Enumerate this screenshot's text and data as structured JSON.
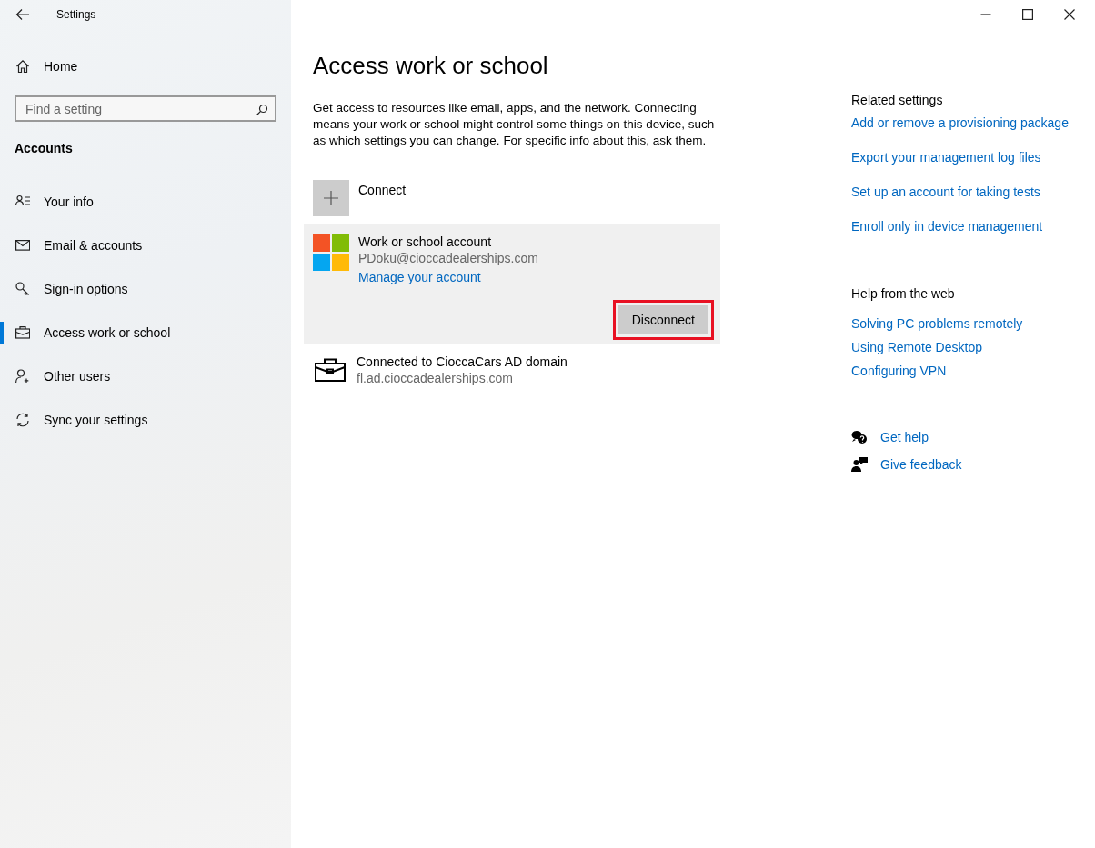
{
  "window": {
    "title": "Settings"
  },
  "sidebar": {
    "home": "Home",
    "search": {
      "placeholder": "Find a setting"
    },
    "section": "Accounts",
    "items": [
      {
        "label": "Your info",
        "selected": false
      },
      {
        "label": "Email & accounts",
        "selected": false
      },
      {
        "label": "Sign-in options",
        "selected": false
      },
      {
        "label": "Access work or school",
        "selected": true
      },
      {
        "label": "Other users",
        "selected": false
      },
      {
        "label": "Sync your settings",
        "selected": false
      }
    ]
  },
  "main": {
    "title": "Access work or school",
    "description": "Get access to resources like email, apps, and the network. Connecting means your work or school might control some things on this device, such as which settings you can change. For specific info about this, ask them.",
    "connect": "Connect",
    "accounts": [
      {
        "kind": "microsoft",
        "title": "Work or school account",
        "subtitle": "PDoku@cioccadealerships.com",
        "link": "Manage your account",
        "expanded": true,
        "button": {
          "label": "Disconnect",
          "highlighted": true
        }
      },
      {
        "kind": "domain",
        "title": "Connected to CioccaCars AD domain",
        "subtitle": "fl.ad.cioccadealerships.com",
        "expanded": false
      }
    ]
  },
  "related": {
    "heading": "Related settings",
    "links": [
      "Add or remove a provisioning package",
      "Export your management log files",
      "Set up an account for taking tests",
      "Enroll only in device management"
    ]
  },
  "help": {
    "heading": "Help from the web",
    "links": [
      "Solving PC problems remotely",
      "Using Remote Desktop",
      "Configuring VPN"
    ]
  },
  "support": [
    {
      "kind": "help",
      "label": "Get help"
    },
    {
      "kind": "feedback",
      "label": "Give feedback"
    }
  ]
}
